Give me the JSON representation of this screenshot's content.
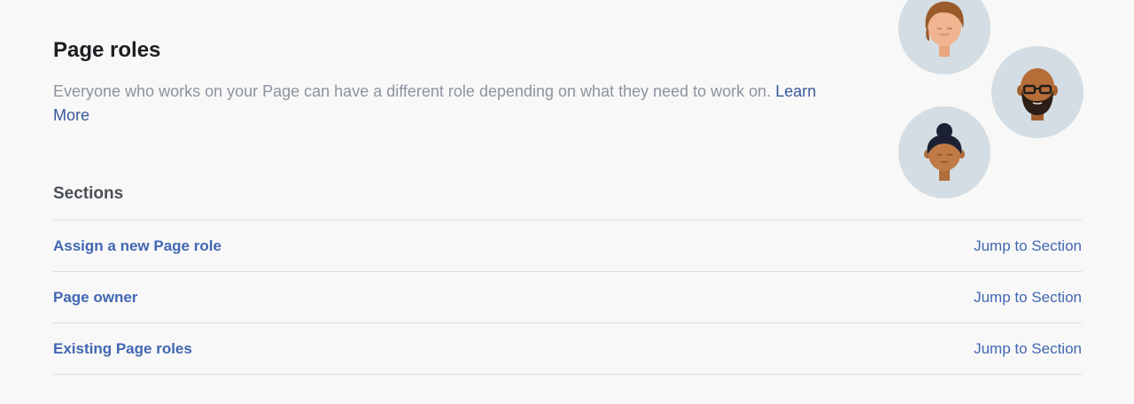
{
  "header": {
    "title": "Page roles",
    "description": "Everyone who works on your Page can have a different role depending on what they need to work on.",
    "learn_more": "Learn More"
  },
  "sections": {
    "title": "Sections",
    "rows": [
      {
        "label": "Assign a new Page role",
        "link": "Jump to Section"
      },
      {
        "label": "Page owner",
        "link": "Jump to Section"
      },
      {
        "label": "Existing Page roles",
        "link": "Jump to Section"
      }
    ]
  },
  "illustration": {
    "avatars": [
      "person-short-hair-icon",
      "person-bald-glasses-beard-icon",
      "person-hair-bun-icon"
    ]
  },
  "colors": {
    "background": "#f8f8f8",
    "link_blue": "#4267b2",
    "muted_text": "#8d949e",
    "avatar_bg": "#d3dde3"
  }
}
